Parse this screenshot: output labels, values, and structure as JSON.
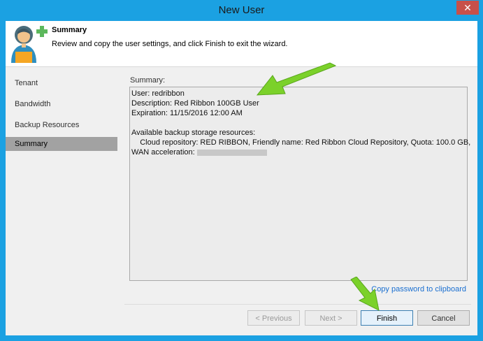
{
  "window": {
    "title": "New User",
    "close_glyph": "✕"
  },
  "header": {
    "title": "Summary",
    "subtitle": "Review and copy the user settings, and click Finish to exit the wizard.",
    "icon": "user-add-icon"
  },
  "nav": {
    "items": [
      {
        "label": "Tenant",
        "active": false
      },
      {
        "label": "Bandwidth",
        "active": false
      },
      {
        "label": "Backup Resources",
        "active": false
      },
      {
        "label": "Summary",
        "active": true
      }
    ]
  },
  "summary": {
    "label": "Summary:",
    "lines": [
      "User: redribbon",
      "Description: Red Ribbon 100GB User",
      "Expiration: 11/15/2016 12:00 AM",
      "",
      "Available backup storage resources:",
      "    Cloud repository: RED RIBBON, Friendly name: Red Ribbon Cloud Repository, Quota: 100.0 GB,",
      "WAN acceleration: "
    ]
  },
  "copy_link": "Copy password to clipboard",
  "buttons": {
    "previous": "< Previous",
    "next": "Next >",
    "finish": "Finish",
    "cancel": "Cancel"
  },
  "colors": {
    "accent": "#1ba1e2",
    "close": "#c7504a",
    "annotation_arrow": "#7bd12a"
  }
}
